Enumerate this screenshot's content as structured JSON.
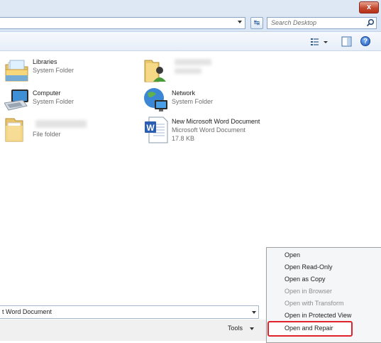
{
  "window": {
    "close_label": "x"
  },
  "address_bar": {
    "refresh_label": "↹",
    "search_placeholder": "Search Desktop"
  },
  "toolbar": {
    "help_label": "?"
  },
  "items": [
    {
      "name": "Libraries",
      "type": "System Folder",
      "icon": "libraries-icon"
    },
    {
      "name": "",
      "type": "",
      "icon": "user-folder-icon"
    },
    {
      "name": "Computer",
      "type": "System Folder",
      "icon": "computer-icon"
    },
    {
      "name": "Network",
      "type": "System Folder",
      "icon": "network-icon"
    },
    {
      "name": "",
      "type": "File folder",
      "icon": "folder-icon"
    },
    {
      "name": "New Microsoft Word Document",
      "type": "Microsoft Word Document",
      "size": "17.8 KB",
      "icon": "word-document-icon"
    }
  ],
  "footer": {
    "file_type_value": "t Word Document",
    "tools_label": "Tools"
  },
  "open_menu": {
    "items": [
      {
        "label": "Open",
        "enabled": true
      },
      {
        "label": "Open Read-Only",
        "enabled": true
      },
      {
        "label": "Open as Copy",
        "enabled": true
      },
      {
        "label": "Open in Browser",
        "enabled": false
      },
      {
        "label": "Open with Transform",
        "enabled": false
      },
      {
        "label": "Open in Protected View",
        "enabled": true
      },
      {
        "label": "Open and Repair",
        "enabled": true,
        "highlighted": true
      }
    ],
    "highlight_color": "#e0232a"
  }
}
